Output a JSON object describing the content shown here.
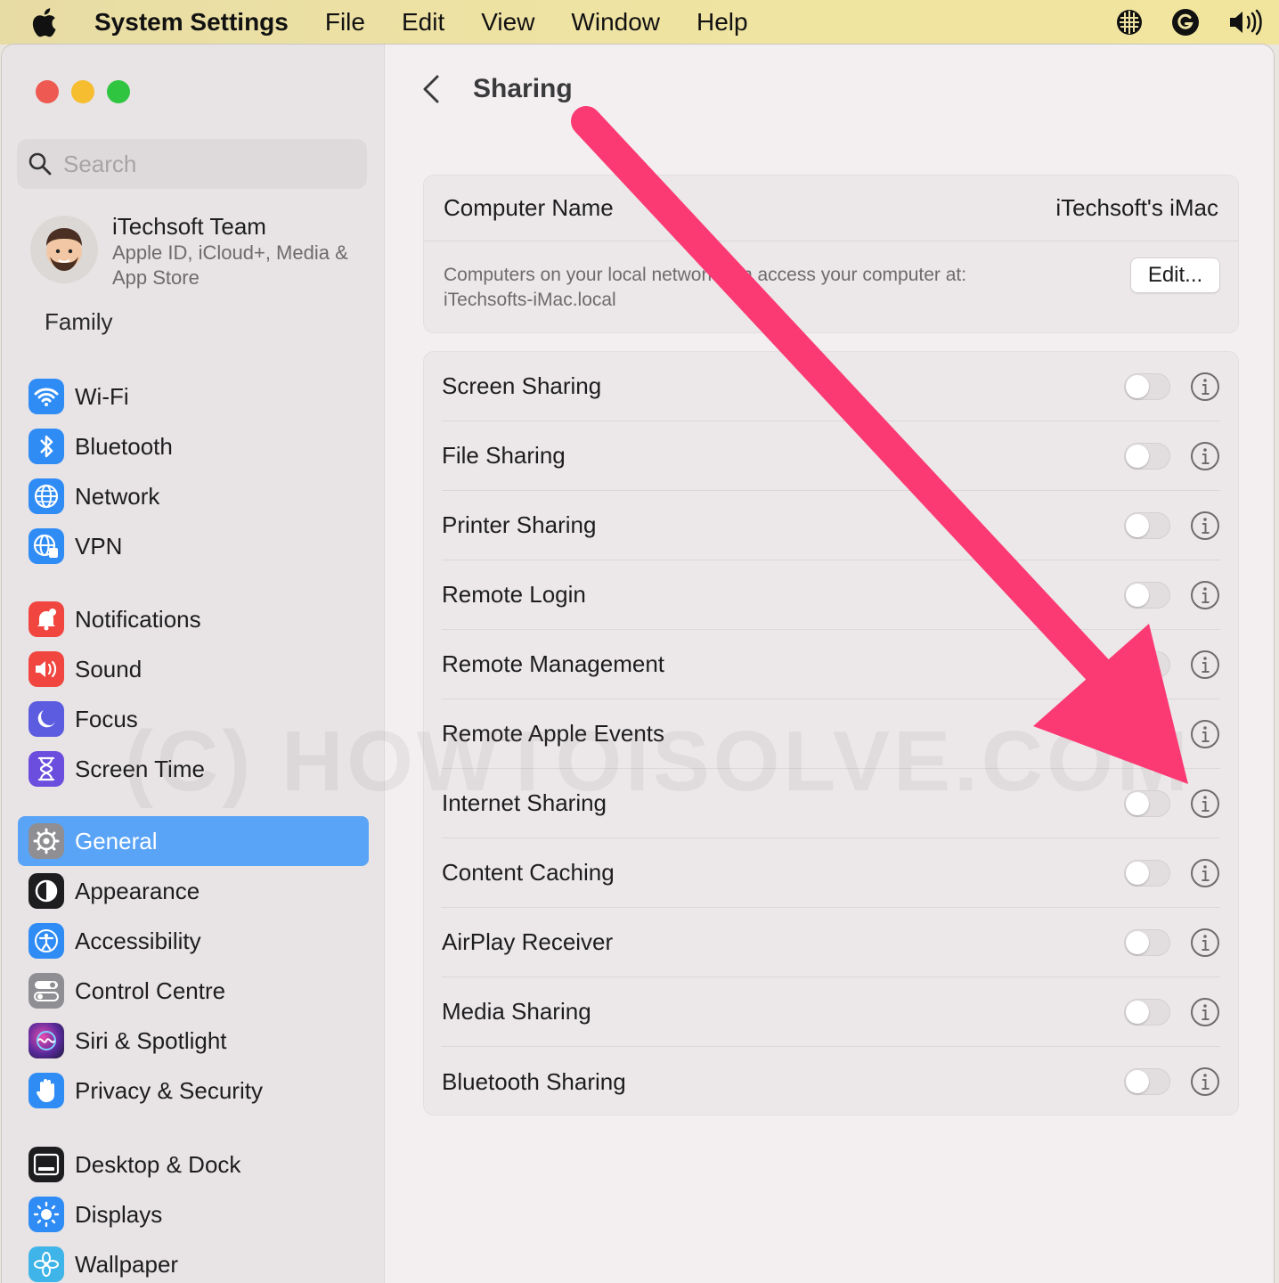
{
  "menubar": {
    "app_name": "System Settings",
    "items": [
      "File",
      "Edit",
      "View",
      "Window",
      "Help"
    ]
  },
  "sidebar": {
    "search_placeholder": "Search",
    "account": {
      "name": "iTechsoft Team",
      "subtitle": "Apple ID, iCloud+, Media & App Store"
    },
    "family_label": "Family",
    "groups": [
      [
        {
          "label": "Wi-Fi",
          "icon": "wifi-icon",
          "color": "#2f8cf5"
        },
        {
          "label": "Bluetooth",
          "icon": "bluetooth-icon",
          "color": "#2f8cf5"
        },
        {
          "label": "Network",
          "icon": "globe-icon",
          "color": "#2f8cf5"
        },
        {
          "label": "VPN",
          "icon": "vpn-globe-icon",
          "color": "#2f8cf5"
        }
      ],
      [
        {
          "label": "Notifications",
          "icon": "bell-icon",
          "color": "#f0463f"
        },
        {
          "label": "Sound",
          "icon": "speaker-icon",
          "color": "#f0463f"
        },
        {
          "label": "Focus",
          "icon": "moon-icon",
          "color": "#5c5ce0"
        },
        {
          "label": "Screen Time",
          "icon": "hourglass-icon",
          "color": "#6b4ede"
        }
      ],
      [
        {
          "label": "General",
          "icon": "gear-icon",
          "color": "#8e8e93",
          "active": true
        },
        {
          "label": "Appearance",
          "icon": "appearance-icon",
          "color": "#1d1d1f"
        },
        {
          "label": "Accessibility",
          "icon": "accessibility-icon",
          "color": "#2f8cf5"
        },
        {
          "label": "Control Centre",
          "icon": "toggles-icon",
          "color": "#8e8e93"
        },
        {
          "label": "Siri & Spotlight",
          "icon": "siri-icon",
          "color": "#6b3fa0"
        },
        {
          "label": "Privacy & Security",
          "icon": "hand-icon",
          "color": "#2f8cf5"
        }
      ],
      [
        {
          "label": "Desktop & Dock",
          "icon": "dock-icon",
          "color": "#1d1d1f"
        },
        {
          "label": "Displays",
          "icon": "sun-icon",
          "color": "#2f8cf5"
        },
        {
          "label": "Wallpaper",
          "icon": "flower-icon",
          "color": "#3fb4e8"
        }
      ]
    ]
  },
  "main": {
    "title": "Sharing",
    "computer_name_label": "Computer Name",
    "computer_name_value": "iTechsoft's iMac",
    "description_line1": "Computers on your local network can access your computer at:",
    "description_line2": "iTechsofts-iMac.local",
    "edit_button": "Edit...",
    "services": [
      {
        "label": "Screen Sharing",
        "on": false
      },
      {
        "label": "File Sharing",
        "on": false
      },
      {
        "label": "Printer Sharing",
        "on": false
      },
      {
        "label": "Remote Login",
        "on": false
      },
      {
        "label": "Remote Management",
        "on": false
      },
      {
        "label": "Remote Apple Events",
        "on": false
      },
      {
        "label": "Internet Sharing",
        "on": false
      },
      {
        "label": "Content Caching",
        "on": false
      },
      {
        "label": "AirPlay Receiver",
        "on": false
      },
      {
        "label": "Media Sharing",
        "on": false
      },
      {
        "label": "Bluetooth Sharing",
        "on": false
      }
    ]
  },
  "watermark": "(C) HOWTOISOLVE.COM",
  "colors": {
    "arrow": "#fb3a74",
    "selection": "#5aa4f7"
  }
}
